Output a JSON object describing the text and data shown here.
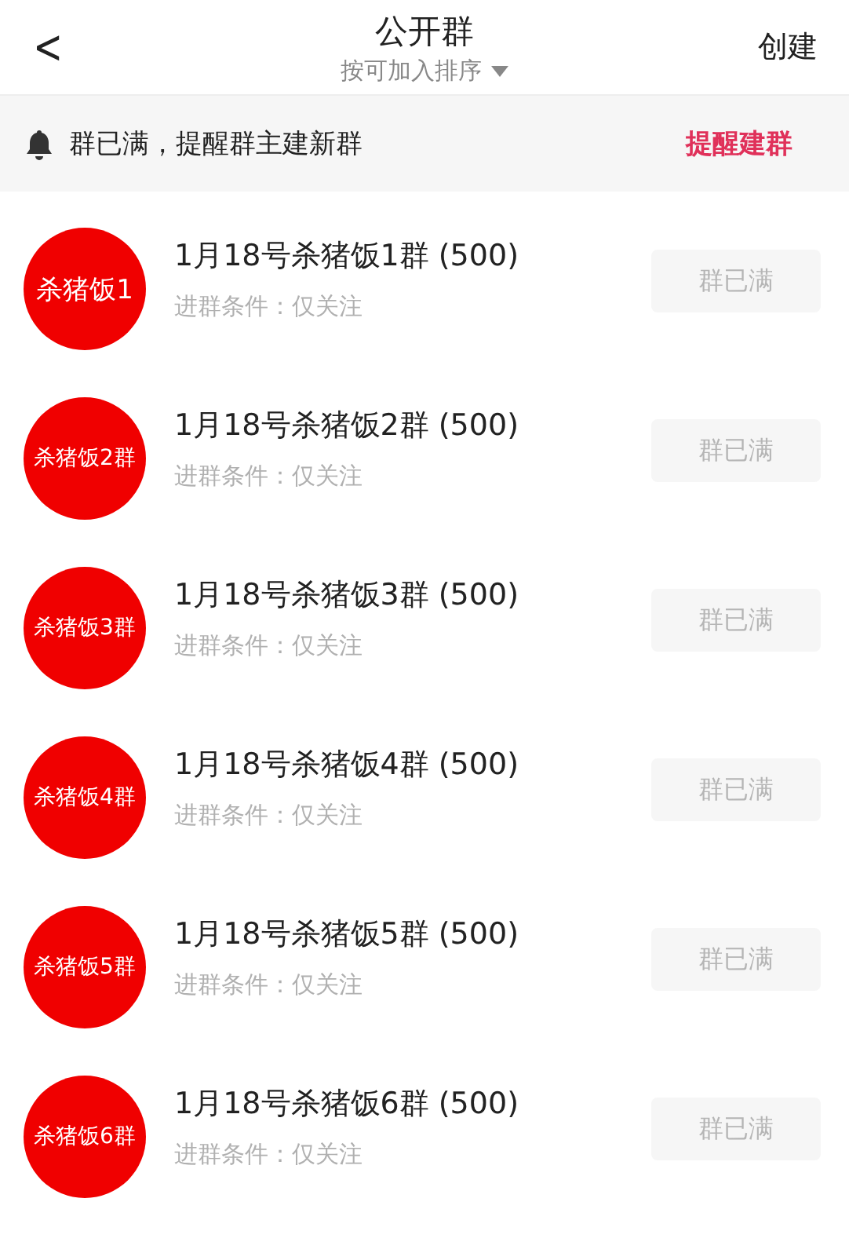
{
  "header": {
    "back": "<",
    "title": "公开群",
    "sort": "按可加入排序",
    "action": "创建"
  },
  "notice": {
    "text": "群已满，提醒群主建新群",
    "action": "提醒建群"
  },
  "groups": [
    {
      "avatar": "杀猪饭1",
      "name": "1月18号杀猪饭1群 (500)",
      "condition": "进群条件：仅关注",
      "button": "群已满",
      "disabled": true
    },
    {
      "avatar": "杀猪饭2群",
      "name": "1月18号杀猪饭2群 (500)",
      "condition": "进群条件：仅关注",
      "button": "群已满",
      "disabled": true
    },
    {
      "avatar": "杀猪饭3群",
      "name": "1月18号杀猪饭3群 (500)",
      "condition": "进群条件：仅关注",
      "button": "群已满",
      "disabled": true
    },
    {
      "avatar": "杀猪饭4群",
      "name": "1月18号杀猪饭4群 (500)",
      "condition": "进群条件：仅关注",
      "button": "群已满",
      "disabled": true
    },
    {
      "avatar": "杀猪饭5群",
      "name": "1月18号杀猪饭5群 (500)",
      "condition": "进群条件：仅关注",
      "button": "群已满",
      "disabled": true
    },
    {
      "avatar": "杀猪饭6群",
      "name": "1月18号杀猪饭6群 (500)",
      "condition": "进群条件：仅关注",
      "button": "群已满",
      "disabled": true
    }
  ]
}
